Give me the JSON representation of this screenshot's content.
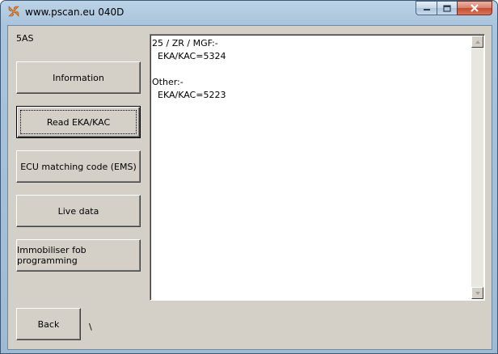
{
  "window": {
    "title": "www.pscan.eu 040D",
    "icon": "pscan-logo-icon",
    "controls": {
      "minimize": "minimize-icon",
      "maximize": "maximize-icon",
      "close": "close-icon"
    }
  },
  "model_label": "5AS",
  "buttons": [
    {
      "label": "Information"
    },
    {
      "label": "Read EKA/KAC"
    },
    {
      "label": "ECU matching code (EMS)"
    },
    {
      "label": "Live data"
    },
    {
      "label": "Immobiliser fob programming"
    }
  ],
  "back_label": "Back",
  "path_text": "\\",
  "output_text": "25 / ZR / MGF:-\n  EKA/KAC=5324\n\nOther:-\n  EKA/KAC=5223"
}
